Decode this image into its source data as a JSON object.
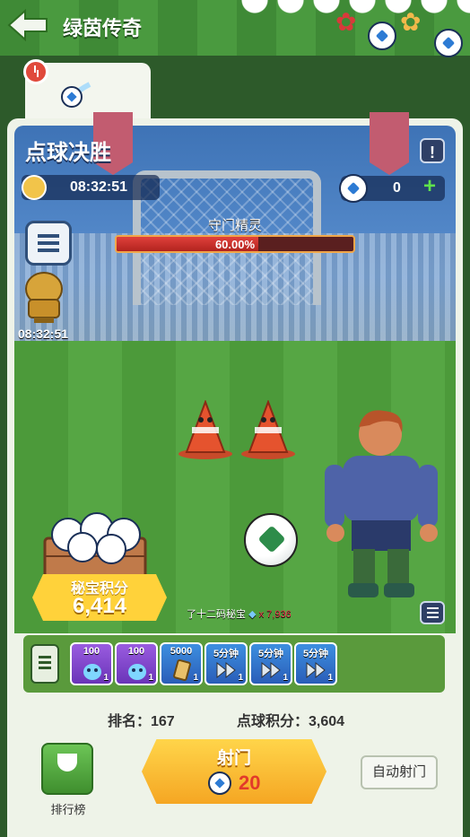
{
  "header": {
    "title": "绿茵传奇",
    "back_icon": "back-arrow-icon"
  },
  "event": {
    "title": "点球决胜",
    "timer": "08:32:51",
    "ball_count": "0",
    "side_timer": "08:32:51"
  },
  "boss": {
    "name": "守门精灵",
    "hp_percent_text": "60.00%",
    "hp_fraction": 0.6
  },
  "treasure": {
    "label": "秘宝积分",
    "value": "6,414",
    "desc": "了十二码秘宝",
    "count": "x 7,936"
  },
  "rewards": [
    {
      "label": "100",
      "qty": "1",
      "style": "purple",
      "icon": "elf-icon"
    },
    {
      "label": "100",
      "qty": "1",
      "style": "purple",
      "icon": "elf-icon"
    },
    {
      "label": "5000",
      "qty": "1",
      "style": "blue",
      "icon": "card-icon"
    },
    {
      "label": "5分钟",
      "qty": "1",
      "style": "blue",
      "icon": "speedup-icon"
    },
    {
      "label": "5分钟",
      "qty": "1",
      "style": "blue",
      "icon": "speedup-icon"
    },
    {
      "label": "5分钟",
      "qty": "1",
      "style": "blue",
      "icon": "speedup-icon"
    }
  ],
  "stats": {
    "rank_text": "排名：167",
    "points_text": "点球积分：3,604"
  },
  "actions": {
    "leaderboard_label": "排行榜",
    "shoot_label": "射门",
    "shoot_cost": "20",
    "auto_shoot_label": "自动射门"
  },
  "colors": {
    "hp_bar": "#e0413b",
    "shoot_button": "#f5a623",
    "score_box": "#ffd23a"
  }
}
